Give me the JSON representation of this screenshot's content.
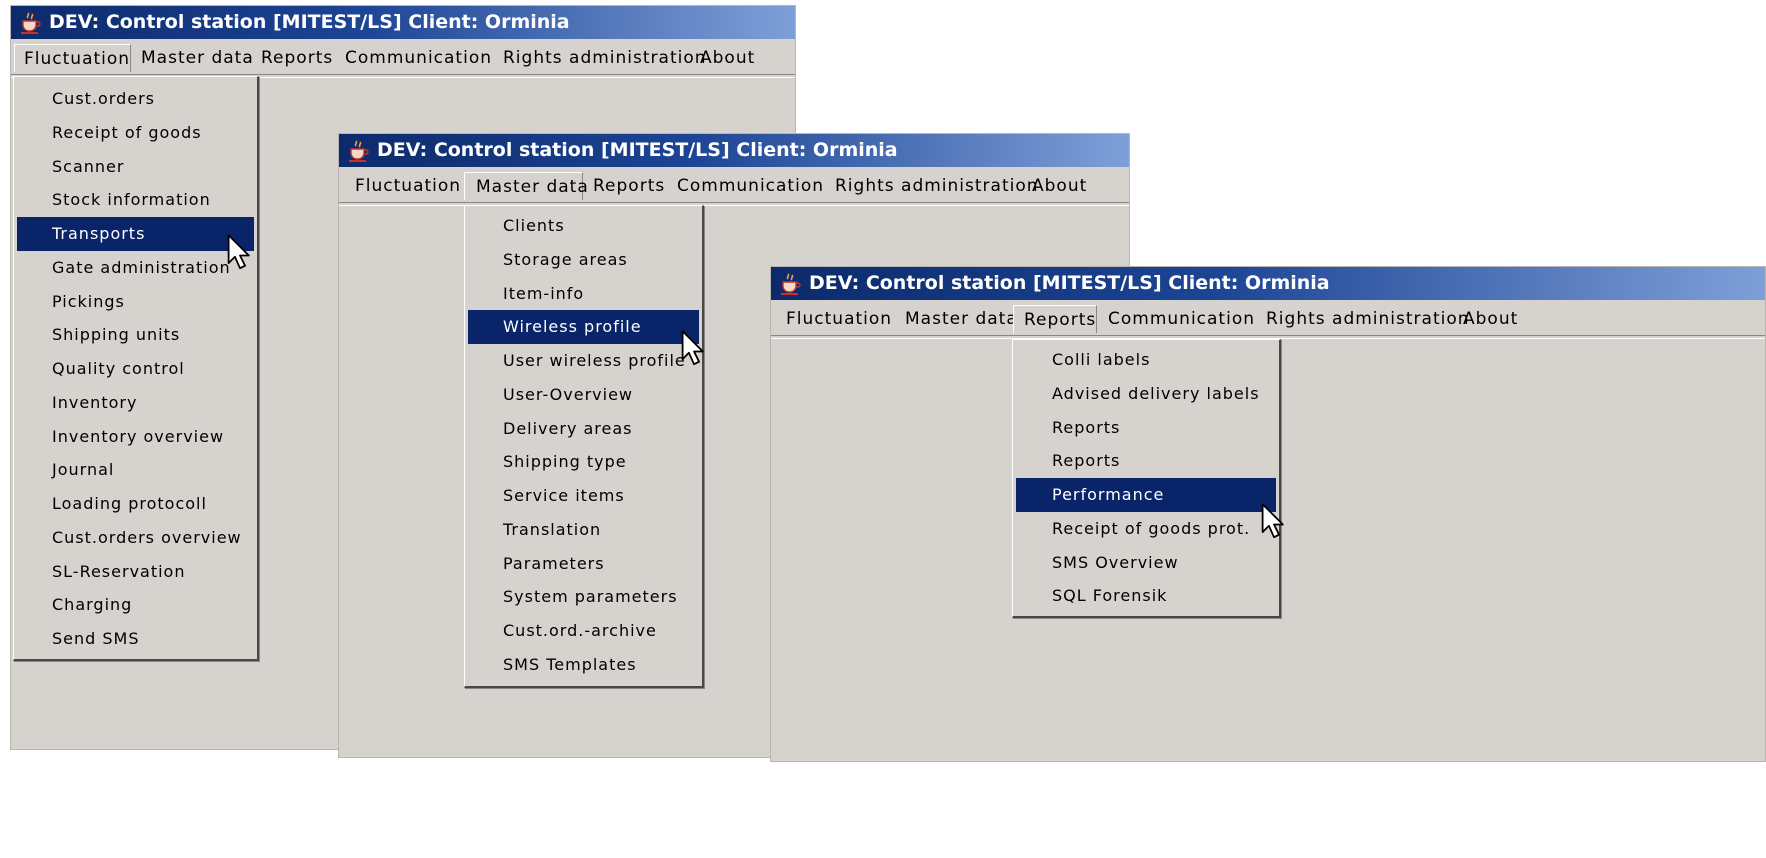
{
  "windows": [
    {
      "title": "DEV: Control station [MITEST/LS]  Client: Orminia",
      "menubar": [
        "Fluctuation",
        "Master data",
        "Reports",
        "Communication",
        "Rights administration",
        "About"
      ],
      "open_menu": "Fluctuation",
      "items": [
        "Cust.orders",
        "Receipt of goods",
        "Scanner",
        "Stock information",
        "Transports",
        "Gate administration",
        "Pickings",
        "Shipping units",
        "Quality control",
        "Inventory",
        "Inventory overview",
        "Journal",
        "Loading protocoll",
        "Cust.orders overview",
        "SL-Reservation",
        "Charging",
        "Send SMS"
      ],
      "selected_item": "Transports"
    },
    {
      "title": "DEV: Control station [MITEST/LS]  Client: Orminia",
      "menubar": [
        "Fluctuation",
        "Master data",
        "Reports",
        "Communication",
        "Rights administration",
        "About"
      ],
      "open_menu": "Master data",
      "items": [
        "Clients",
        "Storage areas",
        "Item-info",
        "Wireless profile",
        "User wireless profile",
        "User-Overview",
        "Delivery areas",
        "Shipping type",
        "Service items",
        "Translation",
        "Parameters",
        "System parameters",
        "Cust.ord.-archive",
        "SMS Templates"
      ],
      "selected_item": "Wireless profile"
    },
    {
      "title": "DEV: Control station [MITEST/LS]  Client: Orminia",
      "menubar": [
        "Fluctuation",
        "Master data",
        "Reports",
        "Communication",
        "Rights administration",
        "About"
      ],
      "open_menu": "Reports",
      "items": [
        "Colli labels",
        "Advised delivery labels",
        "Reports",
        "Reports",
        "Performance",
        "Receipt of goods prot.",
        "SMS Overview",
        "SQL Forensik"
      ],
      "selected_item": "Performance"
    }
  ],
  "colors": {
    "window_bg": "#d6d3ce",
    "titlebar_dark": "#0c2a6b",
    "titlebar_light": "#7f9fd8",
    "selection": "#0a246a"
  },
  "icons": {
    "app": "java-cup-icon",
    "pointer": "mouse-pointer-icon"
  }
}
